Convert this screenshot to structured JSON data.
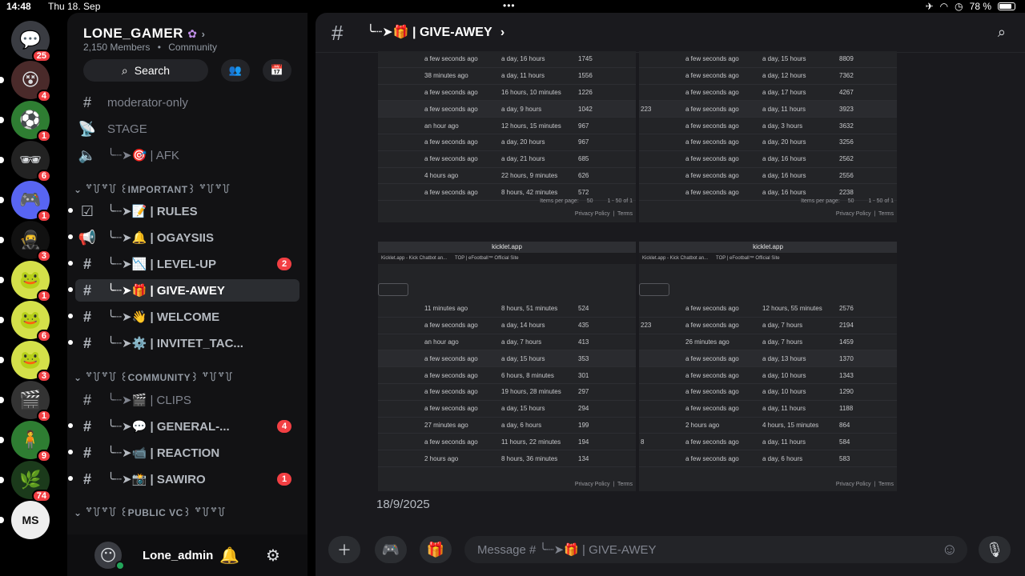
{
  "status": {
    "time": "14:48",
    "date": "Thu 18. Sep",
    "battery": "78 %"
  },
  "servers": [
    {
      "icon": "💬",
      "badge": "25",
      "bg": "#3a3c42"
    },
    {
      "icon": "😵",
      "badge": "4",
      "bg": "#4a2a2a"
    },
    {
      "icon": "⚽",
      "badge": "1",
      "bg": "#2e7d32"
    },
    {
      "icon": "🕶",
      "badge": "6",
      "bg": "#222"
    },
    {
      "icon": "🎮",
      "badge": "1",
      "bg": "#5865f2"
    },
    {
      "icon": "🥷",
      "badge": "3",
      "bg": "#111"
    },
    {
      "icon": "🐸",
      "badge": "1",
      "bg": "#d4e04a"
    },
    {
      "icon": "🐸",
      "badge": "6",
      "bg": "#d4e04a"
    },
    {
      "icon": "🐸",
      "badge": "3",
      "bg": "#d4e04a"
    },
    {
      "icon": "🎬",
      "badge": "1",
      "bg": "#333"
    },
    {
      "icon": "🧍",
      "badge": "9",
      "bg": "#2e7d32"
    },
    {
      "icon": "🌿",
      "badge": "74",
      "bg": "#1b3a1b"
    },
    {
      "icon": "MS",
      "badge": "",
      "bg": "#eee"
    }
  ],
  "server": {
    "name": "LONE_GAMER",
    "members": "2,150 Members",
    "type": "Community"
  },
  "search_label": "Search",
  "channels": {
    "top": [
      {
        "icon": "#",
        "name": "moderator-only"
      },
      {
        "icon": "📡",
        "name": "STAGE"
      },
      {
        "icon": "🔈",
        "name": "╰┈➤🎯 | AFK"
      }
    ],
    "cat_important": "꒷꒦꒷꒦ ꒰IMPORTANT꒱ ꒷꒦꒷꒦",
    "important": [
      {
        "icon": "☑",
        "name": "╰┈➤📝 | RULES",
        "badge": ""
      },
      {
        "icon": "📢",
        "name": "╰┈➤🔔 | OGAYSIIS",
        "badge": ""
      },
      {
        "icon": "#",
        "name": "╰┈➤📉 | LEVEL-UP",
        "badge": "2"
      },
      {
        "icon": "#",
        "name": "╰┈➤🎁 | GIVE-AWEY",
        "badge": ""
      },
      {
        "icon": "#",
        "name": "╰┈➤👋 | WELCOME",
        "badge": ""
      },
      {
        "icon": "#",
        "name": "╰┈➤⚙️ | INVITET_TAC...",
        "badge": ""
      }
    ],
    "cat_community": "꒷꒦꒷꒦ ꒰COMMUNITY꒱ ꒷꒦꒷꒦",
    "community": [
      {
        "icon": "#",
        "name": "╰┈➤🎬 | CLIPS",
        "badge": ""
      },
      {
        "icon": "#",
        "name": "╰┈➤💬 | GENERAL-...",
        "badge": "4"
      },
      {
        "icon": "#",
        "name": "╰┈➤📹 | REACTION",
        "badge": ""
      },
      {
        "icon": "#",
        "name": "╰┈➤📸 | SAWIRO",
        "badge": "1"
      }
    ],
    "cat_public": "꒷꒦꒷꒦ ꒰PUBLIC VC꒱ ꒷꒦꒷꒦"
  },
  "user": {
    "name": "Lone_admin"
  },
  "chat": {
    "title": "╰┈➤🎁 | GIVE-AWEY",
    "date_label": "18/9/2025",
    "placeholder": "Message # ╰┈➤🎁 | GIVE-AWEY"
  },
  "screens": {
    "url": "kicklet.app",
    "tab1": "Kicklet.app - Kick Chatbot an...",
    "tab2": "TOP | eFootball™ Official Site",
    "items_per_page": "Items per page:",
    "per_page_val": "50",
    "range": "1 - 50 of 1",
    "privacy": "Privacy Policy",
    "terms": "Terms",
    "tl": [
      [
        "",
        "a few seconds ago",
        "a day, 16 hours",
        "1745"
      ],
      [
        "",
        "38 minutes ago",
        "a day, 11 hours",
        "1556"
      ],
      [
        "",
        "a few seconds ago",
        "16 hours, 10 minutes",
        "1226"
      ],
      [
        "",
        "a few seconds ago",
        "a day, 9 hours",
        "1042"
      ],
      [
        "",
        "an hour ago",
        "12 hours, 15 minutes",
        "967"
      ],
      [
        "",
        "a few seconds ago",
        "a day, 20 hours",
        "967"
      ],
      [
        "",
        "a few seconds ago",
        "a day, 21 hours",
        "685"
      ],
      [
        "",
        "4 hours ago",
        "22 hours, 9 minutes",
        "626"
      ],
      [
        "",
        "a few seconds ago",
        "8 hours, 42 minutes",
        "572"
      ]
    ],
    "tr": [
      [
        "",
        "a few seconds ago",
        "a day, 15 hours",
        "8809"
      ],
      [
        "",
        "a few seconds ago",
        "a day, 12 hours",
        "7362"
      ],
      [
        "",
        "a few seconds ago",
        "a day, 17 hours",
        "4267"
      ],
      [
        "223",
        "a few seconds ago",
        "a day, 11 hours",
        "3923"
      ],
      [
        "",
        "a few seconds ago",
        "a day, 3 hours",
        "3632"
      ],
      [
        "",
        "a few seconds ago",
        "a day, 20 hours",
        "3256"
      ],
      [
        "",
        "a few seconds ago",
        "a day, 16 hours",
        "2562"
      ],
      [
        "",
        "a few seconds ago",
        "a day, 16 hours",
        "2556"
      ],
      [
        "",
        "a few seconds ago",
        "a day, 16 hours",
        "2238"
      ]
    ],
    "bl": [
      [
        "",
        "11 minutes ago",
        "8 hours, 51 minutes",
        "524"
      ],
      [
        "",
        "a few seconds ago",
        "a day, 14 hours",
        "435"
      ],
      [
        "",
        "an hour ago",
        "a day, 7 hours",
        "413"
      ],
      [
        "",
        "a few seconds ago",
        "a day, 15 hours",
        "353"
      ],
      [
        "",
        "a few seconds ago",
        "6 hours, 8 minutes",
        "301"
      ],
      [
        "",
        "a few seconds ago",
        "19 hours, 28 minutes",
        "297"
      ],
      [
        "",
        "a few seconds ago",
        "a day, 15 hours",
        "294"
      ],
      [
        "",
        "27 minutes ago",
        "a day, 6 hours",
        "199"
      ],
      [
        "",
        "a few seconds ago",
        "11 hours, 22 minutes",
        "194"
      ],
      [
        "",
        "2 hours ago",
        "8 hours, 36 minutes",
        "134"
      ]
    ],
    "br": [
      [
        "",
        "a few seconds ago",
        "12 hours, 55 minutes",
        "2576"
      ],
      [
        "223",
        "a few seconds ago",
        "a day, 7 hours",
        "2194"
      ],
      [
        "",
        "26 minutes ago",
        "a day, 7 hours",
        "1459"
      ],
      [
        "",
        "a few seconds ago",
        "a day, 13 hours",
        "1370"
      ],
      [
        "",
        "a few seconds ago",
        "a day, 10 hours",
        "1343"
      ],
      [
        "",
        "a few seconds ago",
        "a day, 10 hours",
        "1290"
      ],
      [
        "",
        "a few seconds ago",
        "a day, 11 hours",
        "1188"
      ],
      [
        "",
        "2 hours ago",
        "4 hours, 15 minutes",
        "864"
      ],
      [
        "8",
        "a few seconds ago",
        "a day, 11 hours",
        "584"
      ],
      [
        "",
        "a few seconds ago",
        "a day, 6 hours",
        "583"
      ]
    ]
  }
}
